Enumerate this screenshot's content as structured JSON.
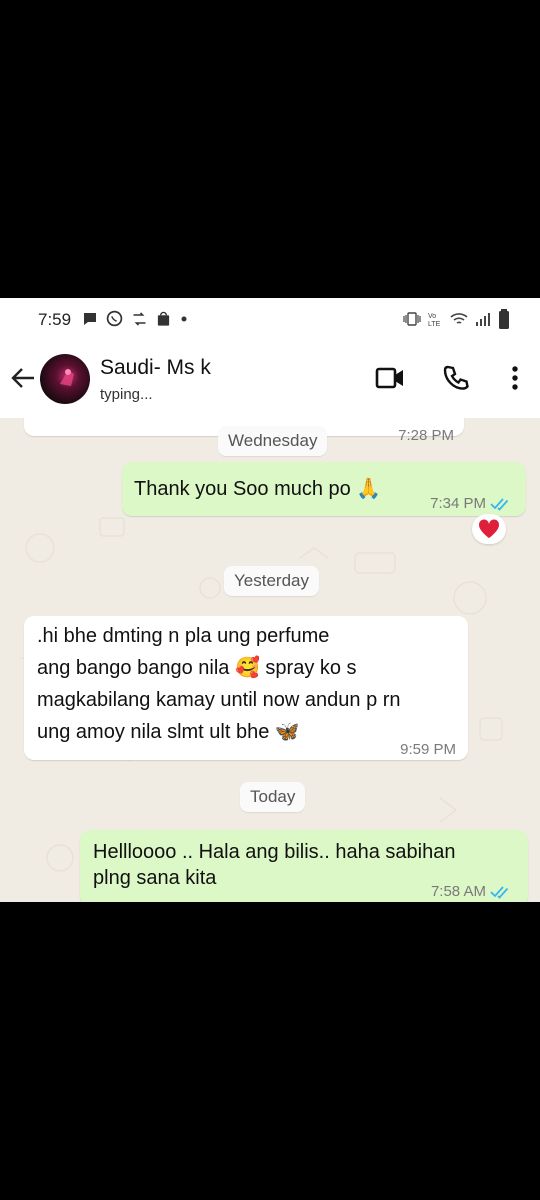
{
  "status_bar": {
    "time": "7:59",
    "left_icons": [
      "chat-bubble-icon",
      "whatsapp-icon",
      "transfer-icon",
      "shopping-bag-icon",
      "dot-icon"
    ],
    "right_icons": [
      "vibrate-icon",
      "volte-icon",
      "wifi-icon",
      "signal-icon",
      "battery-icon"
    ]
  },
  "header": {
    "contact_name": "Saudi- Ms k",
    "status": "typing..."
  },
  "chat": {
    "partial_message_time": "7:28 PM",
    "messages": [
      {
        "type": "date",
        "label": "Wednesday"
      },
      {
        "type": "outgoing",
        "text": "Thank you Soo much po 🙏",
        "time": "7:34 PM",
        "reaction": "❤️"
      },
      {
        "type": "date",
        "label": "Yesterday"
      },
      {
        "type": "incoming",
        "lines": [
          ".hi bhe dmting n pla ung perfume",
          "ang bango bango nila 🥰 spray ko s",
          "magkabilang kamay until now andun p rn",
          "ung amoy nila slmt ult bhe 🦋"
        ],
        "time": "9:59 PM"
      },
      {
        "type": "date",
        "label": "Today"
      },
      {
        "type": "outgoing",
        "lines": [
          "Hellloooo .. Hala ang bilis.. haha sabihan",
          "plng sana kita"
        ],
        "time": "7:58 AM"
      }
    ]
  },
  "colors": {
    "outgoing_bubble": "#dcf8c6",
    "incoming_bubble": "#ffffff",
    "chat_background": "#f0ebe3",
    "read_ticks": "#34b7f1"
  }
}
